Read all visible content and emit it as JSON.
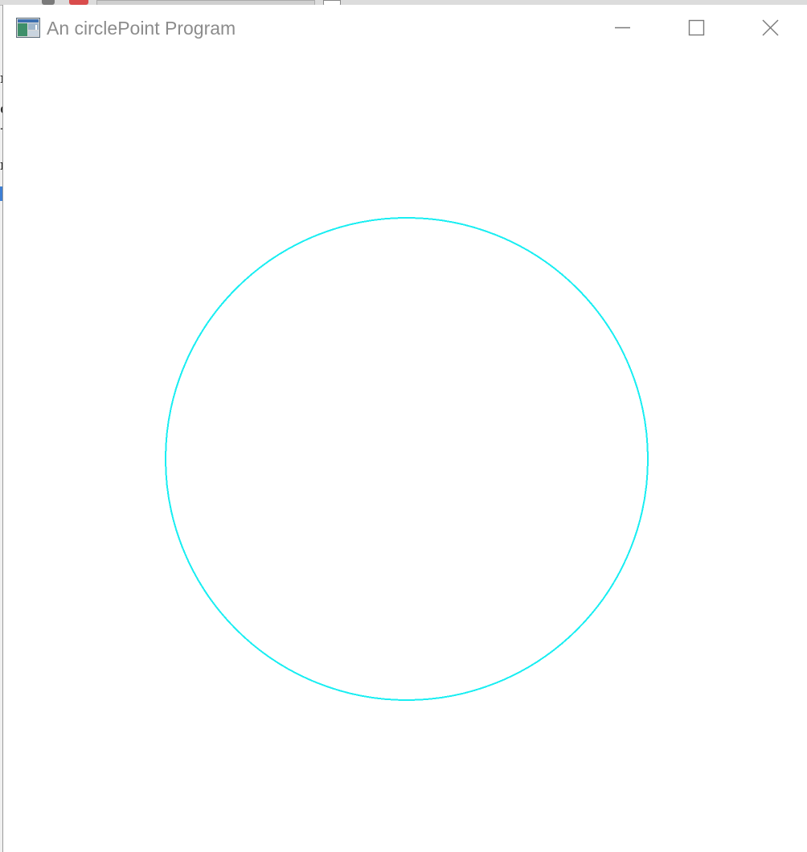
{
  "window": {
    "title": "An circlePoint Program",
    "controls": {
      "minimize_icon": "minimize-icon",
      "maximize_icon": "maximize-icon",
      "close_icon": "close-icon"
    }
  },
  "canvas": {
    "background": "#ffffff",
    "circle": {
      "stroke_color": "#1aeef2",
      "stroke_style": "aliased 1px point plot"
    }
  },
  "background_app": {
    "text_fragments": [
      "r",
      "e",
      "-",
      "n"
    ]
  },
  "colors": {
    "title_text": "#8c8c8c",
    "window_border": "#9a9a9a",
    "circle": "#1aeef2"
  }
}
